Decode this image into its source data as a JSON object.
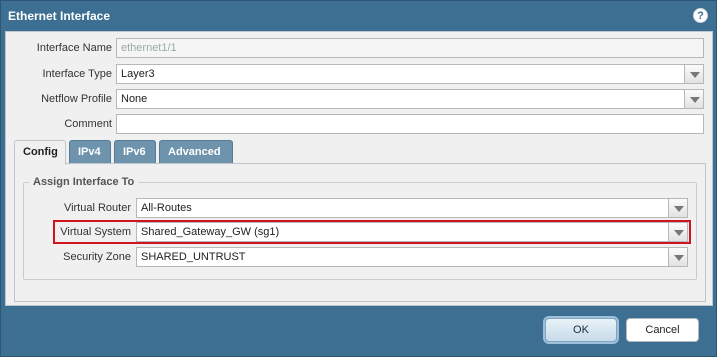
{
  "dialog": {
    "title": "Ethernet Interface",
    "help_icon": "help-icon"
  },
  "fields": {
    "interface_name": {
      "label": "Interface Name",
      "value": "ethernet1/1"
    },
    "interface_type": {
      "label": "Interface Type",
      "value": "Layer3"
    },
    "netflow_profile": {
      "label": "Netflow Profile",
      "value": "None"
    },
    "comment": {
      "label": "Comment",
      "value": ""
    }
  },
  "tabs": [
    {
      "label": "Config",
      "active": true
    },
    {
      "label": "IPv4",
      "active": false
    },
    {
      "label": "IPv6",
      "active": false
    },
    {
      "label": "Advanced",
      "active": false
    }
  ],
  "assign": {
    "legend": "Assign Interface To",
    "virtual_router": {
      "label": "Virtual Router",
      "value": "All-Routes"
    },
    "virtual_system": {
      "label": "Virtual System",
      "value": "Shared_Gateway_GW (sg1)"
    },
    "security_zone": {
      "label": "Security Zone",
      "value": "SHARED_UNTRUST"
    }
  },
  "buttons": {
    "ok": "OK",
    "cancel": "Cancel"
  },
  "colors": {
    "frame": "#3d6f92",
    "tab_inactive": "#6d93ad",
    "highlight": "#d0141e"
  }
}
